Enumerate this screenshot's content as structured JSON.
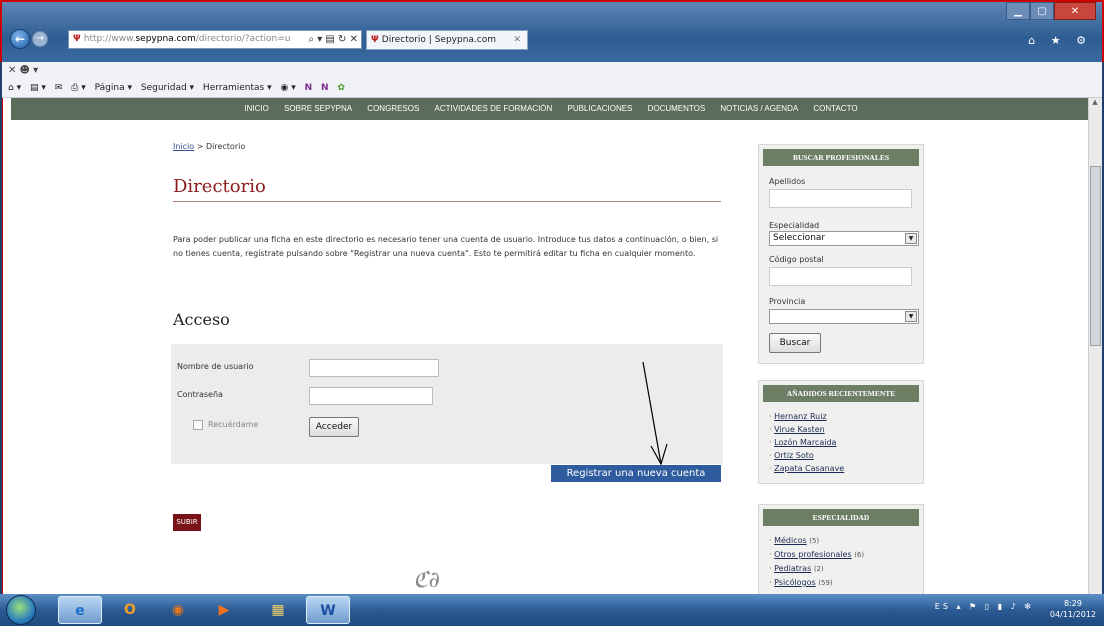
{
  "browser": {
    "address_prefix": "http://www.",
    "address_host": "sepypna.com",
    "address_rest": "/directorio/?action=u",
    "address_icons": "⌕ ▾ ▤ ↻ ✕",
    "tab_title": "Directorio | Sepypna.com",
    "tab_close": "✕",
    "win_min": "▁",
    "win_max": "▢",
    "win_close": "✕",
    "right_icons": "⌂ ★ ⚙"
  },
  "toolbar1": {
    "text": "✕  ☻ ▾"
  },
  "toolbar2": {
    "items": [
      "⌂ ▾",
      "▤ ▾",
      "✉",
      "⎙ ▾",
      "Página ▾",
      "Seguridad ▾",
      "Herramientas ▾",
      "◉ ▾",
      "N",
      "N",
      "✿"
    ]
  },
  "nav": {
    "items": [
      "INICIO",
      "SOBRE SEPYPNA",
      "CONGRESOS",
      "ACTIVIDADES DE FORMACIÓN",
      "PUBLICACIONES",
      "DOCUMENTOS",
      "NOTICIAS / AGENDA",
      "CONTACTO"
    ]
  },
  "breadcrumb": {
    "home": "Inicio",
    "sep": " > ",
    "current": "Directorio"
  },
  "page_title": "Directorio",
  "intro_text": "Para poder publicar una ficha en este directorio es necesario tener una cuenta de usuario. Introduce tus datos a continuación, o bien, si no tienes cuenta, regístrate pulsando sobre \"Registrar una nueva cuenta\". Esto te permitirá editar tu ficha en cualquier momento.",
  "login": {
    "heading": "Acceso",
    "username_label": "Nombre de usuario",
    "password_label": "Contraseña",
    "remember_label": "Recuérdame",
    "submit_label": "Acceder",
    "register_label": "Registrar una nueva cuenta"
  },
  "subir_label": "SUBIR",
  "ornament": "ℭ∂",
  "sidebar": {
    "search": {
      "heading": "BUSCAR PROFESIONALES",
      "apellidos_label": "Apellidos",
      "especialidad_label": "Especialidad",
      "especialidad_value": "Seleccionar",
      "cp_label": "Código postal",
      "provincia_label": "Provincia",
      "provincia_value": "",
      "button_label": "Buscar"
    },
    "recent": {
      "heading": "AÑADIDOS RECIENTEMENTE",
      "items": [
        "Hernanz Ruiz",
        "Virue Kasten",
        "Lozón Marcaida",
        "Ortiz Soto",
        "Zapata Casanave"
      ]
    },
    "specialty": {
      "heading": "ESPECIALIDAD",
      "items": [
        {
          "name": "Médicos",
          "count": "(5)"
        },
        {
          "name": "Otros profesionales",
          "count": "(6)"
        },
        {
          "name": "Pediatras",
          "count": "(2)"
        },
        {
          "name": "Psicólogos",
          "count": "(59)"
        }
      ]
    }
  },
  "taskbar": {
    "lang": "ES",
    "tray_icons": "▴ ⚑ ▯ ▮ ♪ ✻",
    "time": "8:29",
    "date": "04/11/2012",
    "apps": [
      "e",
      "O",
      "◉",
      "▶",
      "▦",
      "W"
    ]
  },
  "colors": {
    "nav_bg": "#5b6c5b",
    "title_red": "#8b1a1a",
    "register_blue": "#2f5c9e",
    "subir_bg": "#7a1318"
  }
}
